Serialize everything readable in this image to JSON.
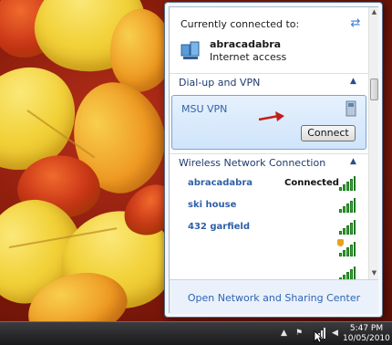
{
  "flyout": {
    "connected_title": "Currently connected to:",
    "current_network": {
      "name": "abracadabra",
      "status": "Internet access"
    },
    "sections": {
      "dialup": "Dial-up and VPN",
      "wireless": "Wireless Network Connection"
    },
    "vpn": {
      "name": "MSU VPN",
      "connect_label": "Connect"
    },
    "wireless_networks": [
      {
        "name": "abracadabra",
        "status": "Connected",
        "signal_bars": 5,
        "secured": false
      },
      {
        "name": "ski house",
        "status": "",
        "signal_bars": 5,
        "secured": false
      },
      {
        "name": "432 garfield",
        "status": "",
        "signal_bars": 5,
        "secured": false
      },
      {
        "name": "",
        "status": "",
        "signal_bars": 5,
        "secured": true
      },
      {
        "name": "",
        "status": "",
        "signal_bars": 5,
        "secured": false
      }
    ],
    "footer_link": "Open Network and Sharing Center",
    "colors": {
      "link_blue": "#2c63b5",
      "signal_green": "#2fa52f",
      "vpn_highlight": "#cfe4fb",
      "arrow_red": "#c0201a"
    }
  },
  "taskbar": {
    "time": "5:47 PM",
    "date": "10/05/2010",
    "tray_icons": [
      "chevron-up-icon",
      "flag-icon",
      "network-icon",
      "volume-icon"
    ]
  }
}
